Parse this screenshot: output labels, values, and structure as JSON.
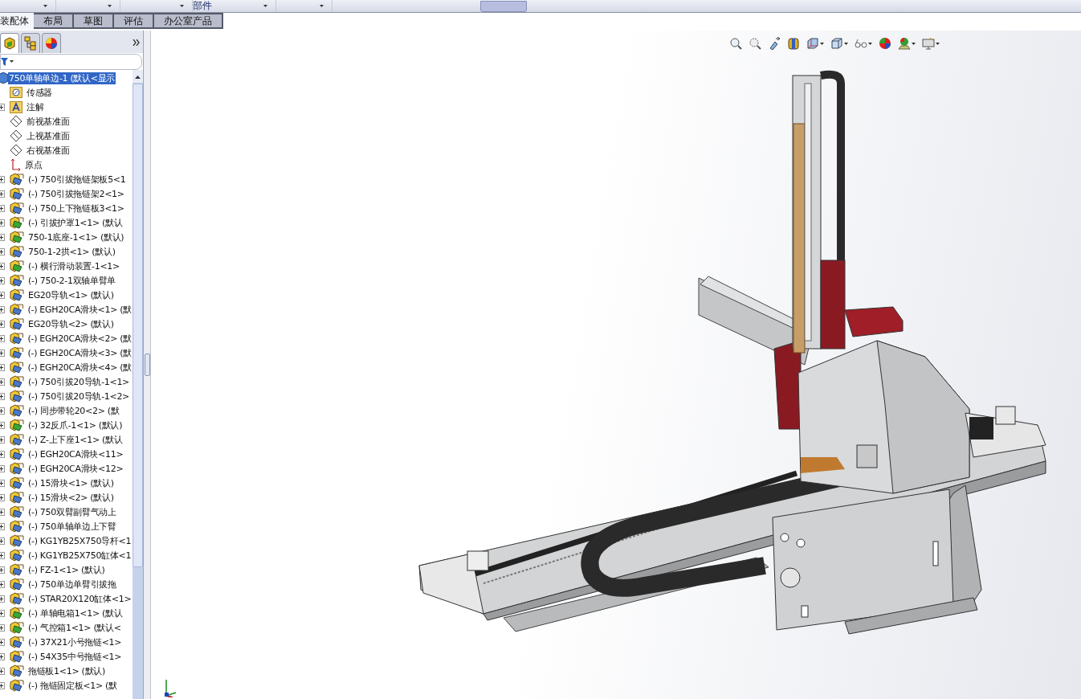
{
  "ribbon": {
    "label": "部件"
  },
  "command_tabs": [
    {
      "label": "装配体",
      "selected": true
    },
    {
      "label": "布局",
      "selected": false
    },
    {
      "label": "草图",
      "selected": false
    },
    {
      "label": "评估",
      "selected": false
    },
    {
      "label": "办公室产品",
      "selected": false
    }
  ],
  "panel_tabs": [
    {
      "kind": "feature",
      "selected": true
    },
    {
      "kind": "property",
      "selected": false
    },
    {
      "kind": "appearance",
      "selected": false
    }
  ],
  "tree": {
    "root": {
      "label": "750单轴单边-1  (默认<显示",
      "selected": true
    },
    "items": [
      {
        "kind": "sensor",
        "label": "传感器"
      },
      {
        "kind": "annotation",
        "label": "注解",
        "expanded": false
      },
      {
        "kind": "plane",
        "label": "前视基准面"
      },
      {
        "kind": "plane",
        "label": "上视基准面"
      },
      {
        "kind": "plane",
        "label": "右视基准面"
      },
      {
        "kind": "origin",
        "label": "原点"
      },
      {
        "kind": "part",
        "label": "(-) 750引拔拖链架板5<1",
        "expanded": false
      },
      {
        "kind": "part",
        "label": "(-) 750引拔拖链架2<1>",
        "expanded": false
      },
      {
        "kind": "part",
        "label": "(-) 750上下拖链板3<1>",
        "expanded": false
      },
      {
        "kind": "assembly",
        "label": "(-) 引拔护罩1<1> (默认",
        "expanded": false
      },
      {
        "kind": "assembly",
        "label": "750-1底座-1<1> (默认)",
        "expanded": false
      },
      {
        "kind": "part",
        "label": "750-1-2拱<1> (默认)",
        "expanded": false
      },
      {
        "kind": "assembly",
        "label": "(-) 横行滑动装置-1<1>",
        "expanded": false
      },
      {
        "kind": "part",
        "label": "(-) 750-2-1双轴单臂单",
        "expanded": false
      },
      {
        "kind": "part",
        "label": "EG20导轨<1> (默认)",
        "expanded": false
      },
      {
        "kind": "part",
        "label": "(-) EGH20CA滑块<1> (默",
        "expanded": false
      },
      {
        "kind": "part",
        "label": "EG20导轨<2> (默认)",
        "expanded": false
      },
      {
        "kind": "part",
        "label": "(-) EGH20CA滑块<2> (默",
        "expanded": false
      },
      {
        "kind": "part",
        "label": "(-) EGH20CA滑块<3> (默",
        "expanded": false
      },
      {
        "kind": "part",
        "label": "(-) EGH20CA滑块<4> (默",
        "expanded": false
      },
      {
        "kind": "part",
        "label": "(-) 750引拔20导轨-1<1>",
        "expanded": false
      },
      {
        "kind": "part",
        "label": "(-) 750引拔20导轨-1<2>",
        "expanded": false
      },
      {
        "kind": "part",
        "label": "(-) 同步带轮20<2> (默",
        "expanded": false
      },
      {
        "kind": "assembly",
        "label": "(-) 32反爪-1<1> (默认)",
        "expanded": false
      },
      {
        "kind": "part",
        "label": "(-) Z-上下座1<1> (默认",
        "expanded": false
      },
      {
        "kind": "part",
        "label": "(-) EGH20CA滑块<11>",
        "expanded": false
      },
      {
        "kind": "part",
        "label": "(-) EGH20CA滑块<12>",
        "expanded": false
      },
      {
        "kind": "part",
        "label": "(-) 15滑块<1> (默认)",
        "expanded": false
      },
      {
        "kind": "part",
        "label": "(-) 15滑块<2> (默认)",
        "expanded": false
      },
      {
        "kind": "part",
        "label": "(-) 750双臂副臂气动上",
        "expanded": false
      },
      {
        "kind": "part",
        "label": "(-) 750单轴单边上下臂",
        "expanded": false
      },
      {
        "kind": "part",
        "label": "(-) KG1YB25X750导杆<1",
        "expanded": false
      },
      {
        "kind": "part",
        "label": "(-) KG1YB25X750缸体<1",
        "expanded": false
      },
      {
        "kind": "part",
        "label": "(-) FZ-1<1> (默认)",
        "expanded": false
      },
      {
        "kind": "part",
        "label": "(-) 750单边单臂引拔拖",
        "expanded": false
      },
      {
        "kind": "part",
        "label": "(-) STAR20X120缸体<1>",
        "expanded": false
      },
      {
        "kind": "assembly",
        "label": "(-) 单轴电箱1<1> (默认",
        "expanded": false
      },
      {
        "kind": "assembly",
        "label": "(-) 气控箱1<1> (默认<",
        "expanded": false
      },
      {
        "kind": "part",
        "label": "(-) 37X21小号拖链<1>",
        "expanded": false
      },
      {
        "kind": "part",
        "label": "(-) 54X35中号拖链<1>",
        "expanded": false
      },
      {
        "kind": "part",
        "label": "拖链板1<1> (默认)",
        "expanded": false
      },
      {
        "kind": "part",
        "label": "(-) 拖链固定板<1> (默",
        "expanded": false
      }
    ]
  }
}
